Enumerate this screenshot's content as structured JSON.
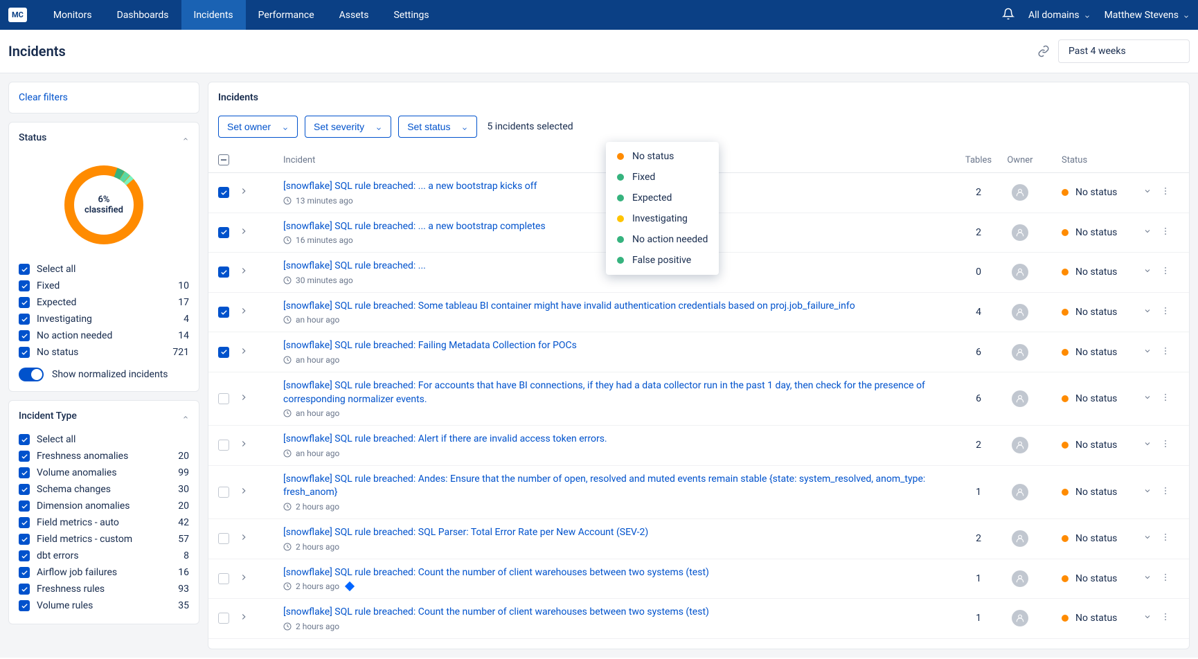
{
  "logo": "MC",
  "nav": [
    "Monitors",
    "Dashboards",
    "Incidents",
    "Performance",
    "Assets",
    "Settings"
  ],
  "nav_active_index": 2,
  "domain_selector": "All domains",
  "user_name": "Matthew Stevens",
  "page_title": "Incidents",
  "date_range": "Past 4 weeks",
  "clear_filters": "Clear filters",
  "status_section": {
    "title": "Status",
    "donut_pct": "6%",
    "donut_label": "classified",
    "select_all": "Select all",
    "filters": [
      {
        "label": "Fixed",
        "count": 10
      },
      {
        "label": "Expected",
        "count": 17
      },
      {
        "label": "Investigating",
        "count": 4
      },
      {
        "label": "No action needed",
        "count": 14
      },
      {
        "label": "No status",
        "count": 721
      }
    ],
    "toggle_label": "Show normalized incidents"
  },
  "type_section": {
    "title": "Incident Type",
    "select_all": "Select all",
    "filters": [
      {
        "label": "Freshness anomalies",
        "count": 20
      },
      {
        "label": "Volume anomalies",
        "count": 99
      },
      {
        "label": "Schema changes",
        "count": 30
      },
      {
        "label": "Dimension anomalies",
        "count": 20
      },
      {
        "label": "Field metrics - auto",
        "count": 42
      },
      {
        "label": "Field metrics - custom",
        "count": 57
      },
      {
        "label": "dbt errors",
        "count": 8
      },
      {
        "label": "Airflow job failures",
        "count": 16
      },
      {
        "label": "Freshness rules",
        "count": 93
      },
      {
        "label": "Volume rules",
        "count": 35
      }
    ]
  },
  "content_title": "Incidents",
  "actions": {
    "set_owner": "Set owner",
    "set_severity": "Set severity",
    "set_status": "Set status",
    "selected_text": "5 incidents selected"
  },
  "status_dropdown": [
    {
      "label": "No status",
      "color": "#ff8b00"
    },
    {
      "label": "Fixed",
      "color": "#36b37e"
    },
    {
      "label": "Expected",
      "color": "#36b37e"
    },
    {
      "label": "Investigating",
      "color": "#ffc400"
    },
    {
      "label": "No action needed",
      "color": "#36b37e"
    },
    {
      "label": "False positive",
      "color": "#36b37e"
    }
  ],
  "columns": {
    "incident": "Incident",
    "tables": "Tables",
    "owner": "Owner",
    "status": "Status"
  },
  "rows": [
    {
      "checked": true,
      "sev": "#e9d8f2",
      "title": "[snowflake] SQL rule breached: ... a new bootstrap kicks off",
      "time": "13 minutes ago",
      "tables": 2,
      "status": "No status",
      "diamond": false
    },
    {
      "checked": true,
      "sev": "#e9d8f2",
      "title": "[snowflake] SQL rule breached: ... a new bootstrap completes",
      "time": "16 minutes ago",
      "tables": 2,
      "status": "No status",
      "diamond": false
    },
    {
      "checked": true,
      "sev": "#e9d8f2",
      "title": "[snowflake] SQL rule breached: ...",
      "time": "30 minutes ago",
      "tables": 0,
      "status": "No status",
      "diamond": false
    },
    {
      "checked": true,
      "sev": "#e9d8f2",
      "title": "[snowflake] SQL rule breached: Some tableau BI container might have invalid authentication credentials based on proj.job_failure_info",
      "time": "an hour ago",
      "tables": 4,
      "status": "No status",
      "diamond": false
    },
    {
      "checked": true,
      "sev": "#e9d8f2",
      "title": "[snowflake] SQL rule breached: Failing Metadata Collection for POCs",
      "time": "an hour ago",
      "tables": 6,
      "status": "No status",
      "diamond": false
    },
    {
      "checked": false,
      "sev": "#e9d8f2",
      "title": "[snowflake] SQL rule breached: For accounts that have BI connections, if they had a data collector run in the past 1 day, then check for the presence of corresponding normalizer events.",
      "time": "an hour ago",
      "tables": 6,
      "status": "No status",
      "diamond": false
    },
    {
      "checked": false,
      "sev": "#e9d8f2",
      "title": "[snowflake] SQL rule breached: Alert if there are invalid access token errors.",
      "time": "an hour ago",
      "tables": 2,
      "status": "No status",
      "diamond": false
    },
    {
      "checked": false,
      "sev": "#b84bd3",
      "title": "[snowflake] SQL rule breached: Andes: Ensure that the number of open, resolved and muted events remain stable {state: system_resolved, anom_type: fresh_anom}",
      "time": "2 hours ago",
      "tables": 1,
      "status": "No status",
      "diamond": false
    },
    {
      "checked": false,
      "sev": "#b84bd3",
      "title": "[snowflake] SQL rule breached: SQL Parser: Total Error Rate per New Account (SEV-2)",
      "time": "2 hours ago",
      "tables": 2,
      "status": "No status",
      "diamond": false
    },
    {
      "checked": false,
      "sev": "#e9d8f2",
      "title": "[snowflake] SQL rule breached: Count the number of client warehouses between two systems (test)",
      "time": "2 hours ago",
      "tables": 1,
      "status": "No status",
      "diamond": true
    },
    {
      "checked": false,
      "sev": "#e9d8f2",
      "title": "[snowflake] SQL rule breached: Count the number of client warehouses between two systems (test)",
      "time": "2 hours ago",
      "tables": 1,
      "status": "No status",
      "diamond": false
    }
  ],
  "colors": {
    "status_dot": "#ff8b00"
  }
}
